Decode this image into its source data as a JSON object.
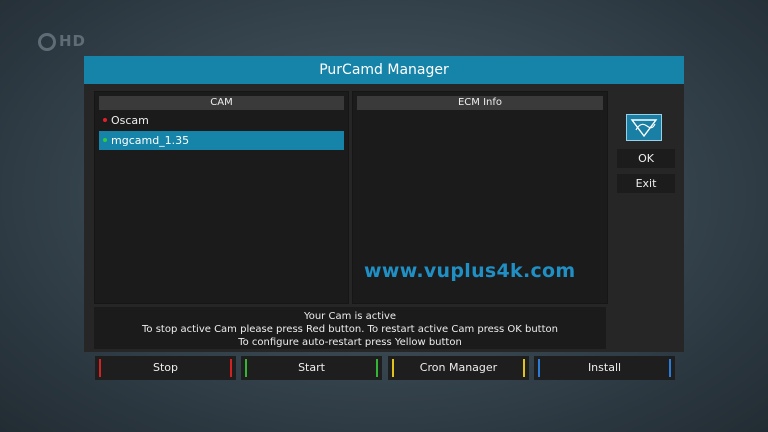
{
  "background": {
    "logo_text": "HD"
  },
  "window": {
    "title": "PurCamd Manager"
  },
  "cam_panel": {
    "header": "CAM",
    "items": [
      {
        "label": "Oscam",
        "status_color": "#e0202a",
        "selected": false
      },
      {
        "label": "mgcamd_1.35",
        "status_color": "#2ecc40",
        "selected": true
      }
    ]
  },
  "ecm_panel": {
    "header": "ECM Info"
  },
  "side_buttons": {
    "ok_label": "OK",
    "exit_label": "Exit"
  },
  "logo_icon": "purcamd-logo-icon",
  "watermark": "www.vuplus4k.com",
  "status": {
    "line1": "Your Cam is active",
    "line2": "To stop active Cam please press Red button. To restart active Cam press OK button",
    "line3": "To configure auto-restart press Yellow button"
  },
  "color_buttons": [
    {
      "label": "Stop",
      "color": "#d42222"
    },
    {
      "label": "Start",
      "color": "#34b534"
    },
    {
      "label": "Cron Manager",
      "color": "#e0c21a"
    },
    {
      "label": "Install",
      "color": "#2a7bd8"
    }
  ],
  "colors": {
    "accent": "#1584a8",
    "watermark": "#1f8fc4"
  }
}
